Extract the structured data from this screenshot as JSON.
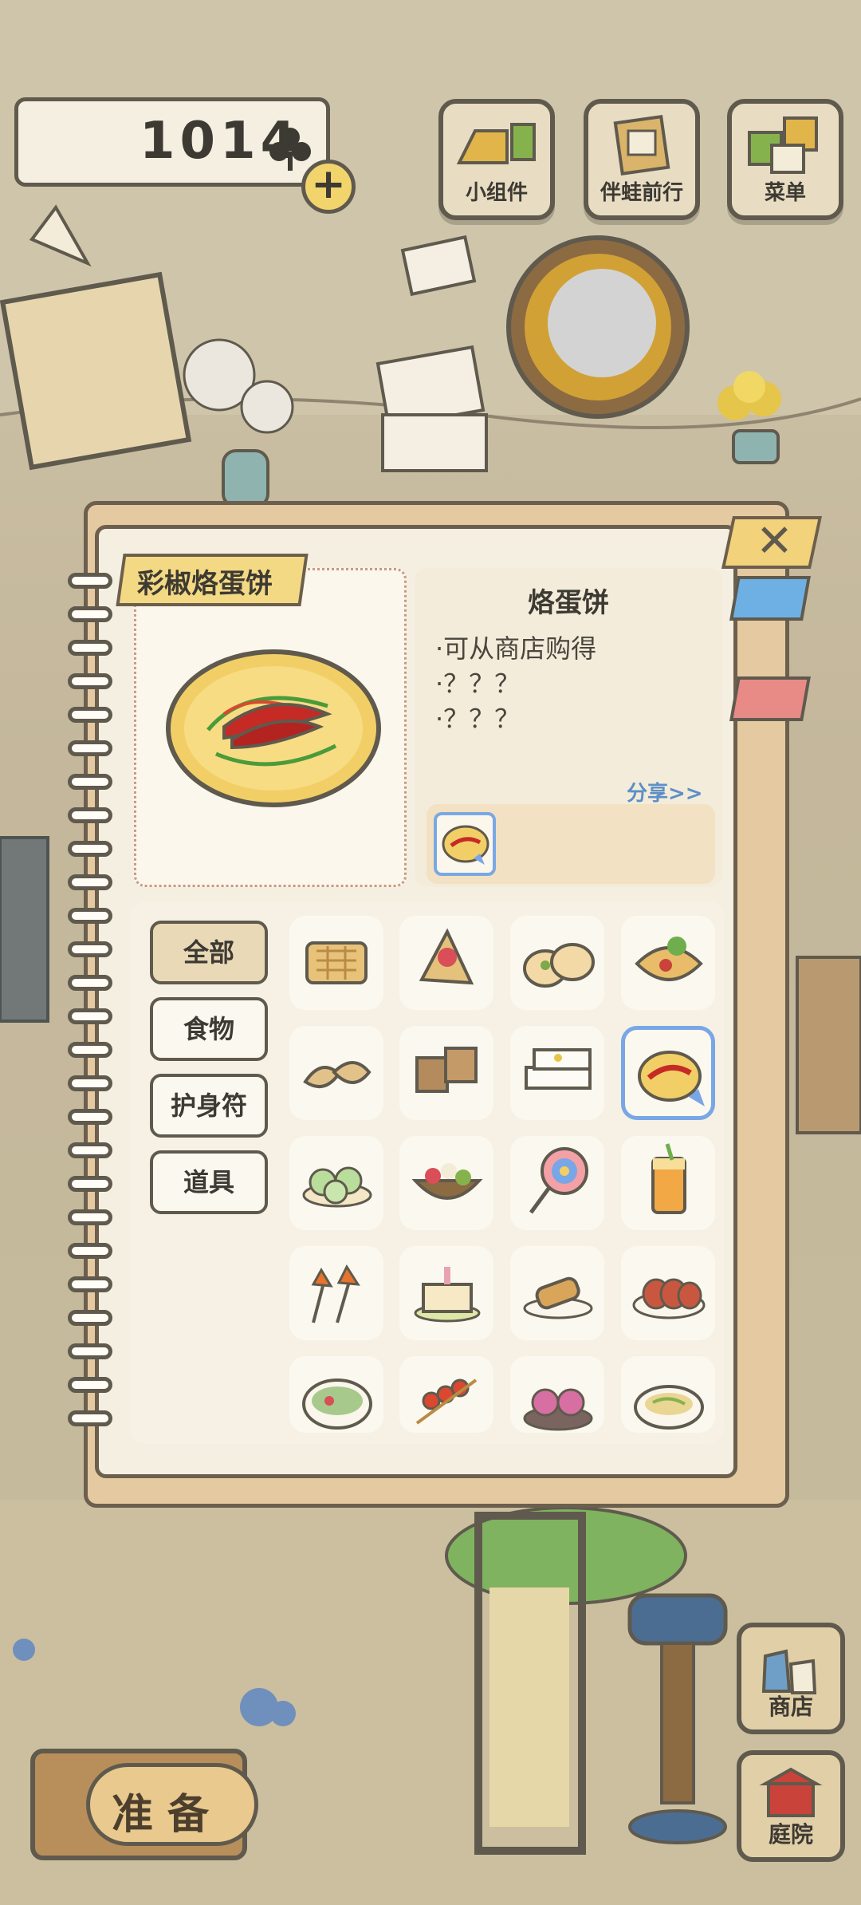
{
  "hud": {
    "currency_value": "1014",
    "currency_icon": "clover-icon",
    "add_icon": "plus-icon"
  },
  "top_buttons": [
    {
      "label": "小组件",
      "icon": "widget-icon"
    },
    {
      "label": "伴蛙前行",
      "icon": "journey-icon"
    },
    {
      "label": "菜单",
      "icon": "menu-icon"
    }
  ],
  "book": {
    "selected_tag": "彩椒烙蛋饼",
    "item_title": "烙蛋饼",
    "description": [
      "·可从商店购得",
      "·？？？",
      "·？？？"
    ],
    "share_label": "分享>>",
    "close_icon": "close-icon",
    "categories": [
      {
        "label": "全部",
        "active": true
      },
      {
        "label": "食物",
        "active": false
      },
      {
        "label": "护身符",
        "active": false
      },
      {
        "label": "道具",
        "active": false
      }
    ],
    "items": [
      {
        "icon": "waffle-sandwich-icon"
      },
      {
        "icon": "crepe-icon"
      },
      {
        "icon": "stuffed-buns-icon"
      },
      {
        "icon": "tortilla-wrap-icon"
      },
      {
        "icon": "dumplings-icon"
      },
      {
        "icon": "tofu-blocks-icon"
      },
      {
        "icon": "rice-cakes-icon"
      },
      {
        "icon": "pepper-omelette-icon",
        "selected": true
      },
      {
        "icon": "green-buns-icon"
      },
      {
        "icon": "fruit-salad-icon"
      },
      {
        "icon": "lollipop-icon"
      },
      {
        "icon": "iced-tea-icon"
      },
      {
        "icon": "maple-leaf-skewers-icon"
      },
      {
        "icon": "cake-icon"
      },
      {
        "icon": "spring-roll-icon"
      },
      {
        "icon": "sausage-platter-icon"
      },
      {
        "icon": "vegetable-soup-icon"
      },
      {
        "icon": "meat-skewers-icon"
      },
      {
        "icon": "mochi-icon"
      },
      {
        "icon": "noodle-soup-icon"
      }
    ]
  },
  "bottom": {
    "prepare_label": "准备",
    "shop_label": "商店",
    "yard_label": "庭院"
  },
  "colors": {
    "accent_blue": "#79a6e6",
    "outline": "#5f5a4d",
    "paper": "#f5efe1",
    "tag_yellow": "#f4d985"
  }
}
